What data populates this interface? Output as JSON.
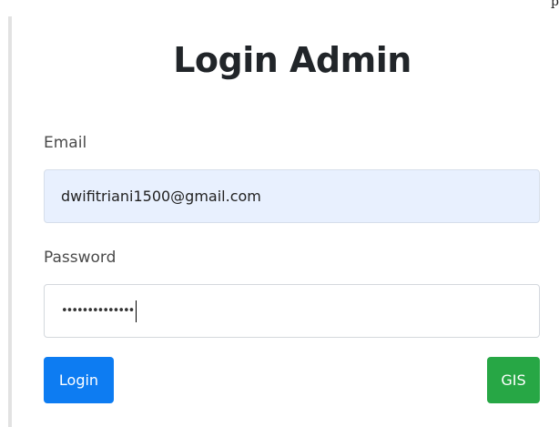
{
  "corner_text": "p",
  "title": "Login Admin",
  "form": {
    "email_label": "Email",
    "email_value": "dwifitriani1500@gmail.com",
    "password_label": "Password",
    "password_value": "••••••••••••••"
  },
  "buttons": {
    "login_label": "Login",
    "gis_label": "GIS"
  },
  "colors": {
    "login_button": "#0d7cf2",
    "gis_button": "#27a745",
    "email_autofill_bg": "#e8f0fe"
  }
}
